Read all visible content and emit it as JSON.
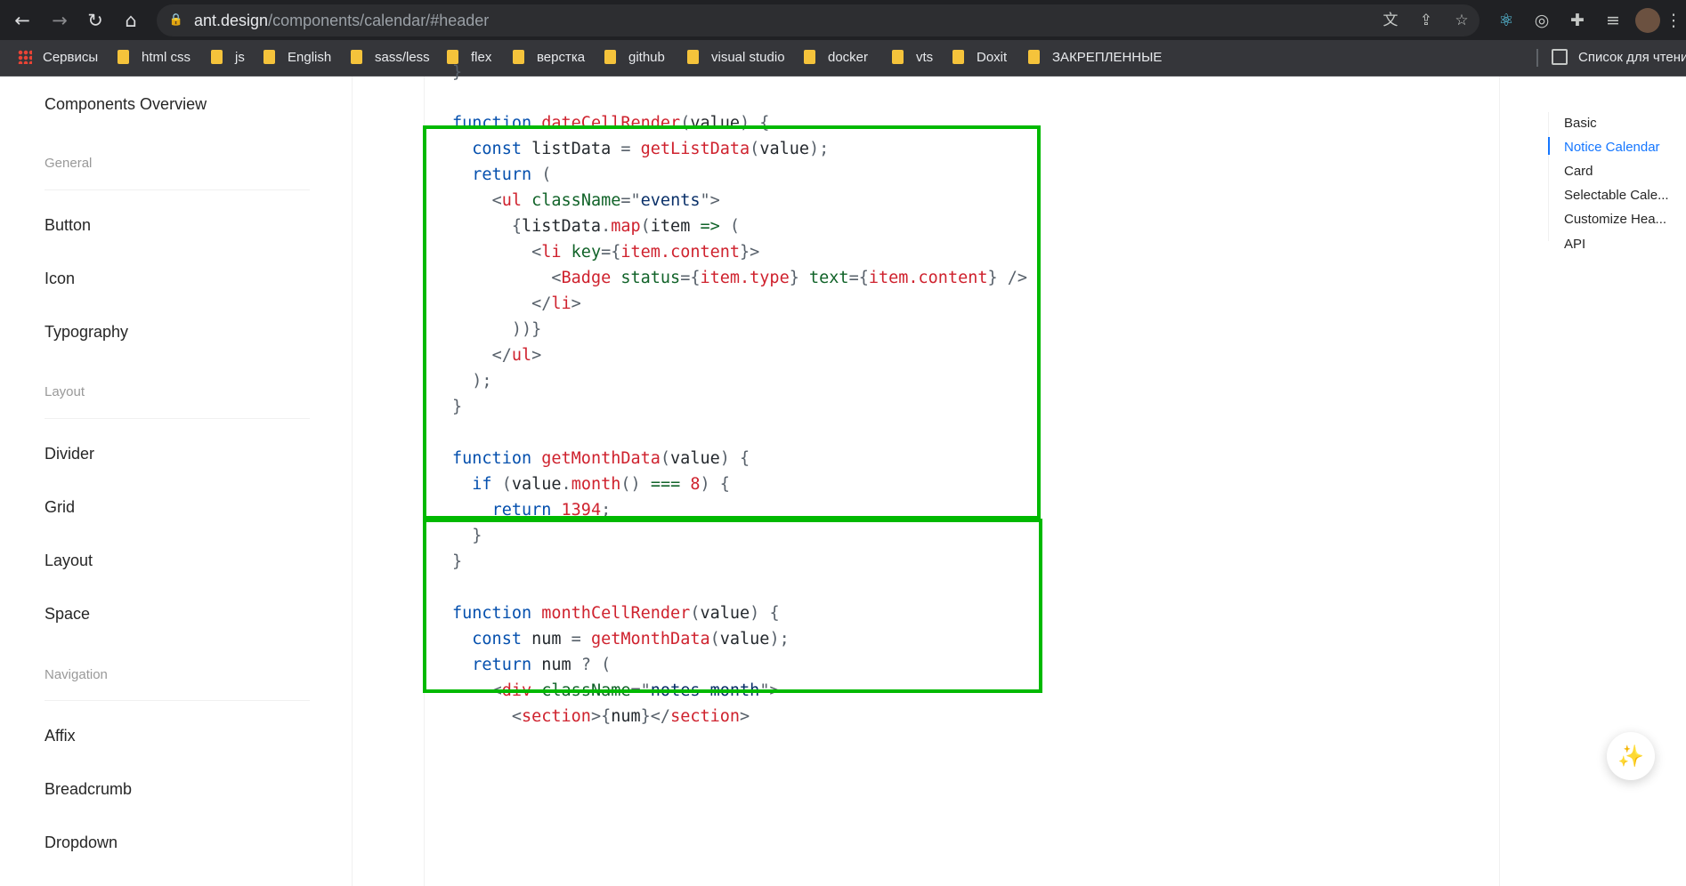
{
  "browser": {
    "url_host": "ant.design",
    "url_path": "/components/calendar/#header",
    "nav_icons": {
      "back": "←",
      "forward": "→",
      "reload": "↻",
      "home": "⌂",
      "lock": "🔒"
    },
    "omnibox_icons": {
      "translate": "文",
      "share": "⇪",
      "star": "☆"
    },
    "ext_icons": {
      "react": "⚛",
      "record": "◎",
      "puzzle": "✚",
      "playlist": "≡",
      "menu": "⋮"
    }
  },
  "bookmarks": {
    "apps": "Сервисы",
    "folders": [
      "html css",
      "js",
      "English",
      "sass/less",
      "flex",
      "верстка",
      "github",
      "visual studio",
      "docker",
      "vts",
      "Doxit",
      "ЗАКРЕПЛЕННЫЕ"
    ],
    "reading_list": "Список для чтения"
  },
  "sidebar": {
    "overview": "Components Overview",
    "groups": {
      "general": "General",
      "layout": "Layout",
      "navigation": "Navigation"
    },
    "items": {
      "button": "Button",
      "icon": "Icon",
      "typography": "Typography",
      "divider": "Divider",
      "grid": "Grid",
      "layout": "Layout",
      "space": "Space",
      "affix": "Affix",
      "breadcrumb": "Breadcrumb",
      "dropdown": "Dropdown"
    }
  },
  "toc": {
    "items": [
      "Basic",
      "Notice Calendar",
      "Card",
      "Selectable Cale...",
      "Customize Hea...",
      "API"
    ],
    "active": "Notice Calendar"
  },
  "code": {
    "lines": [
      {
        "t": "}",
        "k": "p"
      }
    ]
  },
  "fab_icon": "✨",
  "colors": {
    "highlight": "#00b900",
    "link_active": "#1677ff"
  }
}
